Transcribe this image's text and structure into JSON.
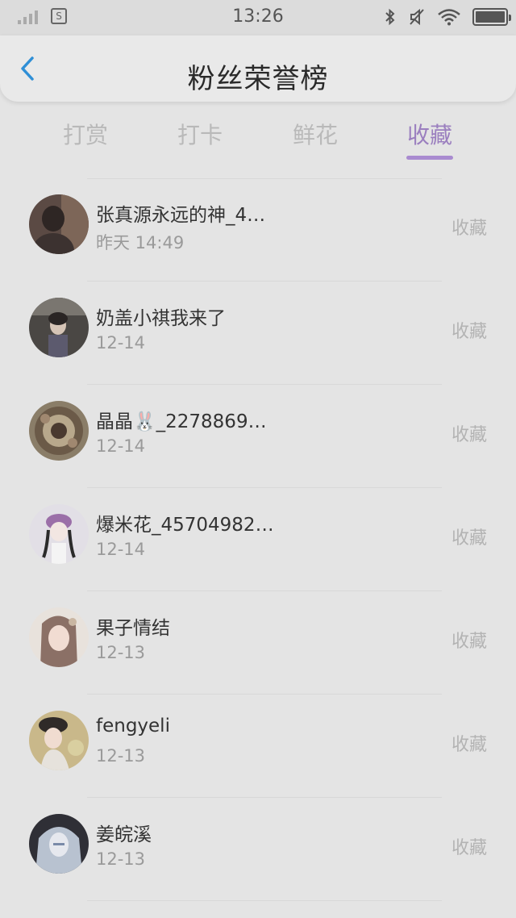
{
  "status_bar": {
    "time": "13:26",
    "sim_label": "S"
  },
  "header": {
    "title": "粉丝荣誉榜",
    "back_icon": "chevron-left-icon"
  },
  "tabs": [
    {
      "label": "打赏",
      "active": false
    },
    {
      "label": "打卡",
      "active": false
    },
    {
      "label": "鲜花",
      "active": false
    },
    {
      "label": "收藏",
      "active": true
    }
  ],
  "colors": {
    "accent": "#a98bd0",
    "back": "#2f8fd6"
  },
  "fans": [
    {
      "name": "张真源永远的神_4…",
      "date": "昨天 14:49",
      "action": "收藏"
    },
    {
      "name": "奶盖小祺我来了",
      "date": "12-14",
      "action": "收藏"
    },
    {
      "name": "晶晶🐰_2278869…",
      "date": "12-14",
      "action": "收藏"
    },
    {
      "name": "爆米花_45704982…",
      "date": "12-14",
      "action": "收藏"
    },
    {
      "name": "果子情结",
      "date": "12-13",
      "action": "收藏"
    },
    {
      "name": "fengyeli",
      "date": "12-13",
      "action": "收藏"
    },
    {
      "name": "姜皖溪",
      "date": "12-13",
      "action": "收藏"
    }
  ]
}
